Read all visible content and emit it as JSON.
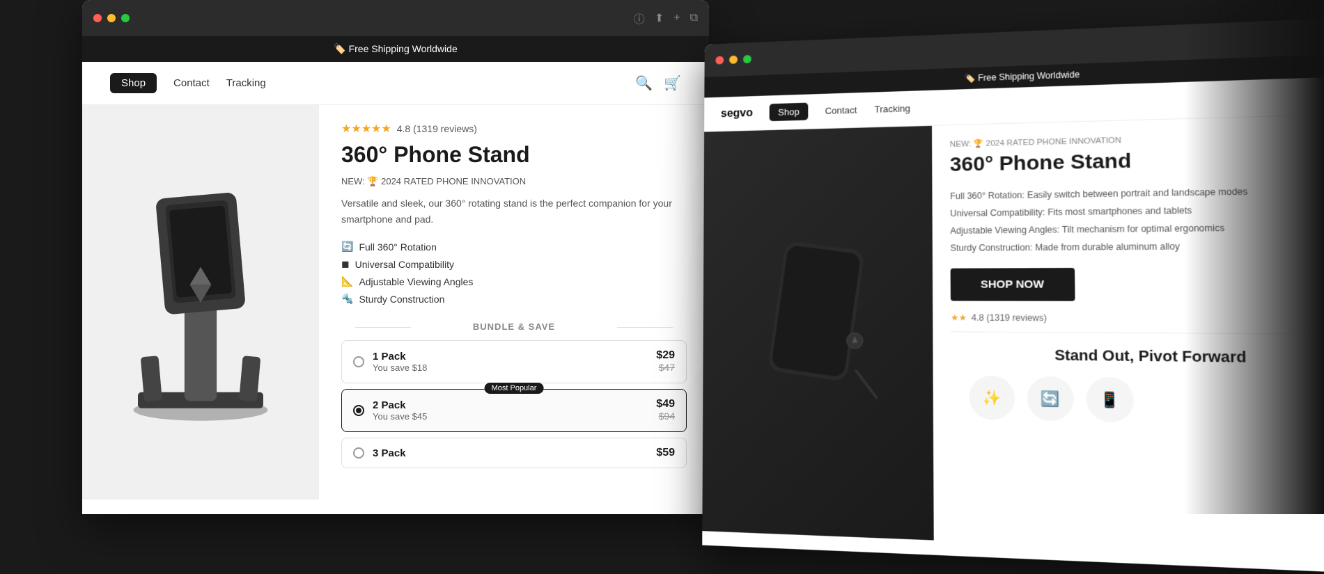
{
  "main_window": {
    "announcement": "🏷️ Free Shipping Worldwide",
    "nav": {
      "logo": "",
      "items": [
        {
          "label": "Shop",
          "active": true
        },
        {
          "label": "Contact",
          "active": false
        },
        {
          "label": "Tracking",
          "active": false
        }
      ]
    },
    "product": {
      "rating_stars": "★★★★★",
      "rating_value": "4.8 (1319 reviews)",
      "title": "360° Phone Stand",
      "badge": "NEW: 🏆 2024 RATED PHONE INNOVATION",
      "description": "Versatile and sleek, our 360° rotating stand is the perfect companion for your smartphone and pad.",
      "features": [
        {
          "icon": "🔄",
          "text": "Full 360° Rotation"
        },
        {
          "icon": "◼",
          "text": "Universal Compatibility"
        },
        {
          "icon": "📐",
          "text": "Adjustable Viewing Angles"
        },
        {
          "icon": "🔩",
          "text": "Sturdy Construction"
        }
      ],
      "bundle_title": "BUNDLE & SAVE",
      "bundles": [
        {
          "name": "1 Pack",
          "savings": "You save $18",
          "price": "$29",
          "original_price": "$47",
          "popular": false,
          "selected": false
        },
        {
          "name": "2 Pack",
          "savings": "You save $45",
          "price": "$49",
          "original_price": "$94",
          "popular": true,
          "popular_label": "Most Popular",
          "selected": true
        },
        {
          "name": "3 Pack",
          "savings": "",
          "price": "$59",
          "original_price": "",
          "popular": false,
          "selected": false
        }
      ]
    }
  },
  "bg_window": {
    "announcement": "🏷️ Free Shipping Worldwide",
    "nav": {
      "logo": "segvo",
      "items": [
        {
          "label": "Shop",
          "active": true
        },
        {
          "label": "Contact",
          "active": false
        },
        {
          "label": "Tracking",
          "active": false
        }
      ]
    },
    "product": {
      "badge": "NEW: 🏆 2024 RATED PHONE INNOVATION",
      "title": "360° Phone Stand",
      "features": [
        "Full 360° Rotation: Easily switch between portrait and landscape modes",
        "Universal Compatibility: Fits most smartphones and tablets",
        "Adjustable Viewing Angles: Tilt mechanism for optimal ergonomics",
        "Sturdy Construction: Made from durable aluminum alloy"
      ],
      "shop_now": "SHOP NOW",
      "rating_stars": "★★",
      "rating_text": "4.8 (1319 reviews)",
      "bottom_title": "Stand Out, Pivot Forward"
    }
  },
  "icons": {
    "search": "🔍",
    "cart": "🛒",
    "circle_info": "ⓘ",
    "share": "⬆",
    "add_tab": "+",
    "windows": "⧉"
  }
}
